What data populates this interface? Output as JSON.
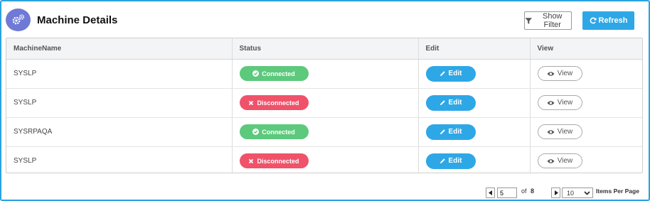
{
  "header": {
    "title": "Machine Details",
    "show_filter": "Show Filter",
    "refresh": "Refresh"
  },
  "table": {
    "columns": [
      "MachineName",
      "Status",
      "Edit",
      "View"
    ],
    "rows": [
      {
        "name": "SYSLP",
        "status": "Connected",
        "status_type": "connected",
        "edit": "Edit",
        "view": "View"
      },
      {
        "name": "SYSLP",
        "status": "Disconnected",
        "status_type": "disconnected",
        "edit": "Edit",
        "view": "View"
      },
      {
        "name": "SYSRPAQA",
        "status": "Connected",
        "status_type": "connected",
        "edit": "Edit",
        "view": "View"
      },
      {
        "name": "SYSLP",
        "status": "Disconnected",
        "status_type": "disconnected",
        "edit": "Edit",
        "view": "View"
      }
    ]
  },
  "pagination": {
    "current_page": "5",
    "of_label": "of",
    "total_pages": "8",
    "page_size": "10",
    "items_per_page_label": "Items Per Page"
  },
  "colors": {
    "accent": "#2ea7e6",
    "connected": "#5cc97c",
    "disconnected": "#f0526a",
    "logo": "#6f79d6"
  },
  "icons": {
    "logo": "gears-icon",
    "filter": "filter-icon",
    "refresh": "refresh-icon",
    "connected": "check-circle-icon",
    "disconnected": "x-icon",
    "edit": "pencil-icon",
    "view": "eye-icon"
  }
}
